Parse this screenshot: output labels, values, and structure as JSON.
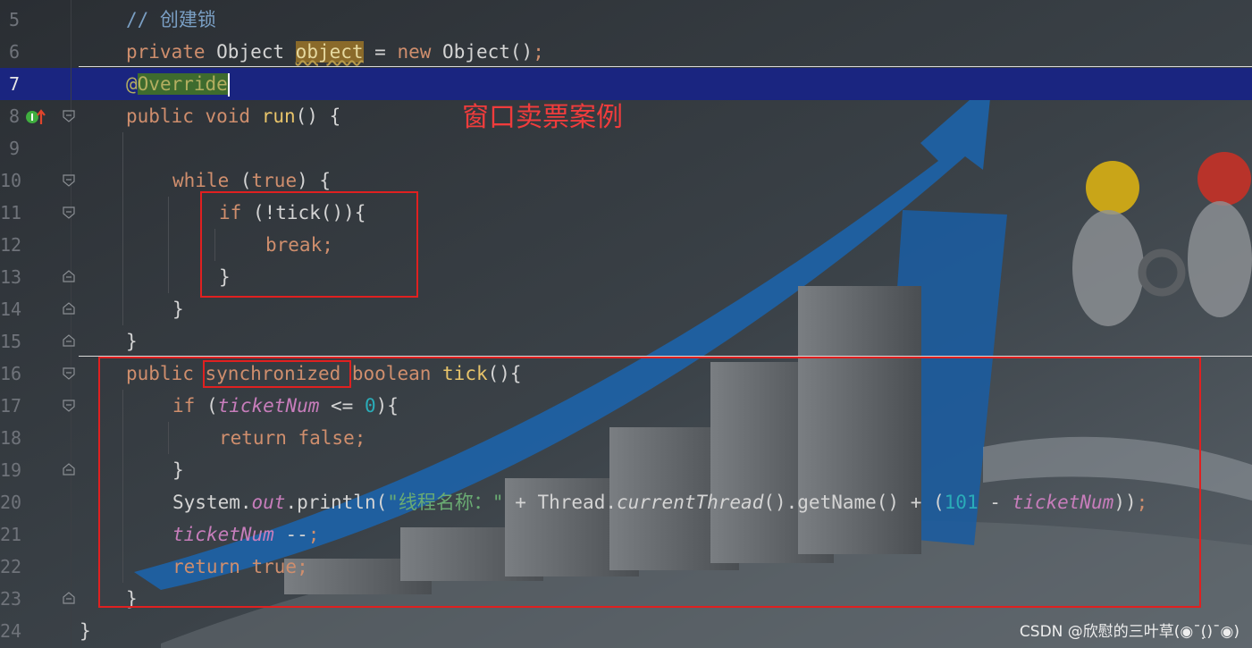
{
  "lines": [
    {
      "n": "5"
    },
    {
      "n": "6"
    },
    {
      "n": "7"
    },
    {
      "n": "8"
    },
    {
      "n": "9"
    },
    {
      "n": "10"
    },
    {
      "n": "11"
    },
    {
      "n": "12"
    },
    {
      "n": "13"
    },
    {
      "n": "14"
    },
    {
      "n": "15"
    },
    {
      "n": "16"
    },
    {
      "n": "17"
    },
    {
      "n": "18"
    },
    {
      "n": "19"
    },
    {
      "n": "20"
    },
    {
      "n": "21"
    },
    {
      "n": "22"
    },
    {
      "n": "23"
    },
    {
      "n": "24"
    }
  ],
  "code": {
    "l5_comment": "// 创建锁",
    "l6_private": "private",
    "l6_type": " Object ",
    "l6_var": "object",
    "l6_eq": " = ",
    "l6_new": "new",
    "l6_ctor": " Object()",
    "l6_semi": ";",
    "l7_at": "@",
    "l7_override": "Override",
    "l8_public": "public",
    "l8_void": " void ",
    "l8_run": "run",
    "l8_rest": "() {",
    "l10_while": "while",
    "l10_open": " (",
    "l10_true": "true",
    "l10_close": ") {",
    "l11_if": "if",
    "l11_rest": " (!tick()){",
    "l12_break": "break;",
    "l13_brace": "}",
    "l14_brace": "}",
    "l15_brace": "}",
    "l16_public": "public",
    "l16_sync": "synchronized",
    "l16_boolean": " boolean ",
    "l16_tick": "tick",
    "l16_rest": "(){",
    "l17_if": "if",
    "l17_open": " (",
    "l17_field": "ticketNum",
    "l17_op": " <= ",
    "l17_zero": "0",
    "l17_close": "){",
    "l18_return": "return false;",
    "l19_brace": "}",
    "l20_sys": "System.",
    "l20_out": "out",
    "l20_println": ".println(",
    "l20_str": "\"线程名称：\"",
    "l20_plus": " + Thread.",
    "l20_cur": "currentThread",
    "l20_getname": "().getName() + (",
    "l20_101": "101",
    "l20_minus": " - ",
    "l20_field": "ticketNum",
    "l20_end": "))",
    "l20_semi": ";",
    "l21_field": "ticketNum",
    "l21_op": " --",
    "l21_semi": ";",
    "l22_return": "return true;",
    "l23_brace": "}",
    "l24_brace": "}"
  },
  "annotation_text": "窗口卖票案例",
  "watermark": "CSDN @欣慰的三叶草(◉¯(̣)¯◉)",
  "gutter_icons": {
    "override_marker": "implements-override-icon"
  },
  "colors": {
    "current_line": "#1a2580",
    "highlight_box": "#e02020",
    "annotation": "#f03c3c"
  }
}
